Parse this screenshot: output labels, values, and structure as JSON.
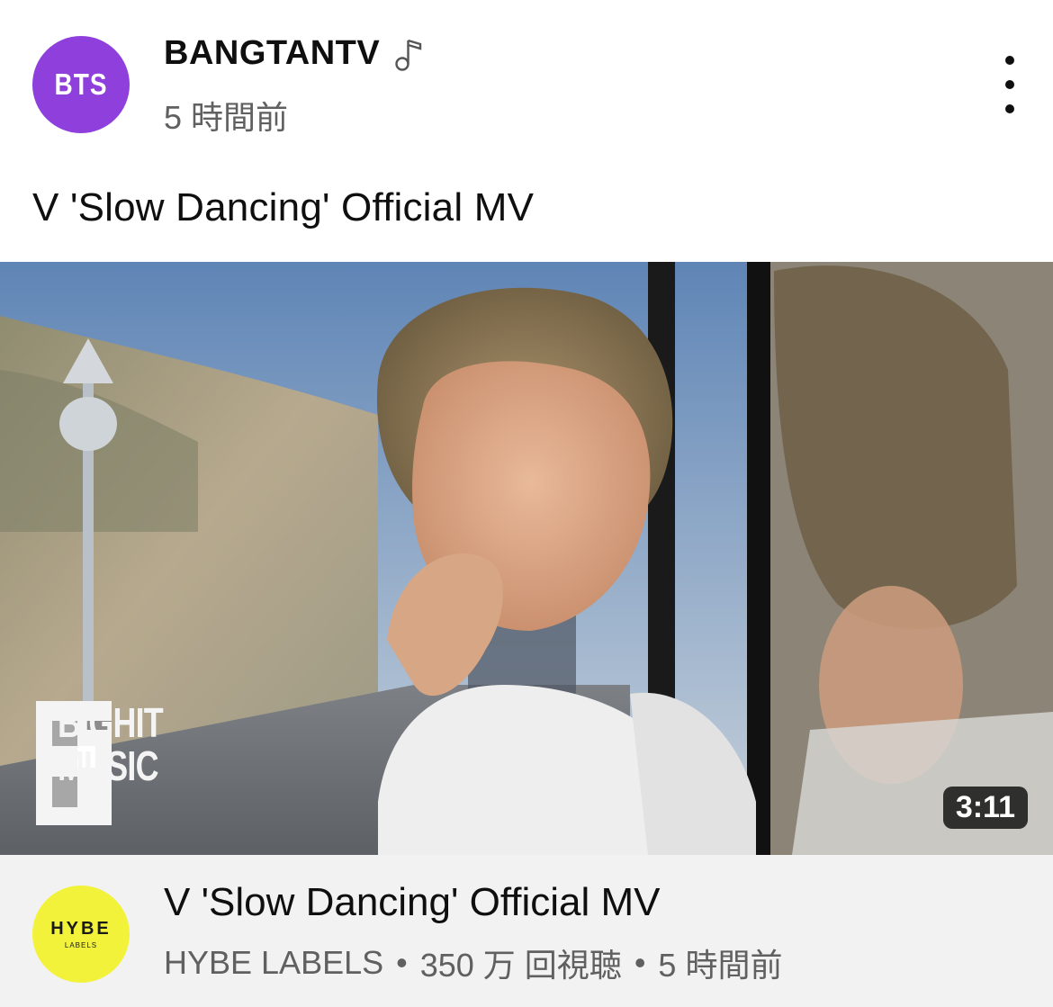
{
  "post": {
    "channel_avatar_text": "BTS",
    "channel_name": "BANGTANTV",
    "time_ago": "5 時間前",
    "text": "V 'Slow Dancing' Official MV"
  },
  "video": {
    "logo_line1": "BIGHIT",
    "logo_line2": "MUSIC",
    "duration": "3:11",
    "title": "V 'Slow Dancing' Official MV",
    "channel_avatar_text": "HYBE",
    "channel_avatar_subtext": "LABELS",
    "channel": "HYBE LABELS",
    "separator": "•",
    "views": "350 万 回視聴",
    "time_ago": "5 時間前"
  },
  "icons": {
    "music_note": "music-note-icon",
    "more": "more-vert-icon"
  },
  "colors": {
    "bts_avatar": "#8e3fdc",
    "hybe_avatar": "#f2f23a",
    "card_bg": "#f2f2f2",
    "secondary_text": "#606060"
  }
}
